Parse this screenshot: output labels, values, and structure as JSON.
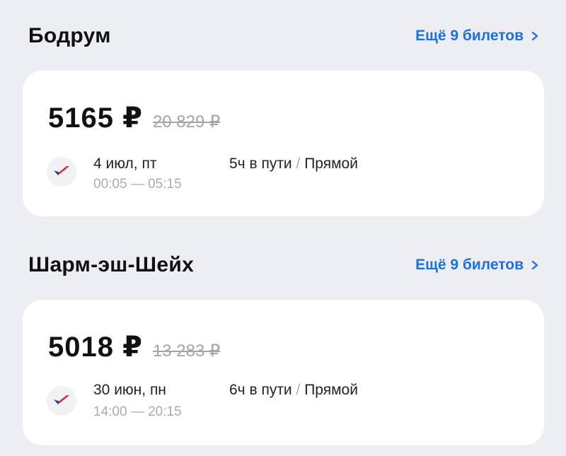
{
  "sections": [
    {
      "title": "Бодрум",
      "more_label": "Ещё 9 билетов",
      "ticket": {
        "price": "5165 ₽",
        "old_price": "20 829 ₽",
        "date": "4 июл, пт",
        "times": "00:05 — 05:15",
        "duration": "5ч в пути",
        "separator": "/",
        "type": "Прямой"
      }
    },
    {
      "title": "Шарм-эш-Шейх",
      "more_label": "Ещё 9 билетов",
      "ticket": {
        "price": "5018 ₽",
        "old_price": "13 283 ₽",
        "date": "30 июн, пн",
        "times": "14:00 — 20:15",
        "duration": "6ч в пути",
        "separator": "/",
        "type": "Прямой"
      }
    }
  ],
  "colors": {
    "background": "#eceef3",
    "card": "#ffffff",
    "link": "#1e6fe0",
    "muted": "#a8acb3",
    "logo_red": "#e5243b",
    "logo_blue": "#1f3c9c"
  },
  "icons": {
    "more": "chevron-right-icon",
    "airline": "airline-logo-icon"
  }
}
